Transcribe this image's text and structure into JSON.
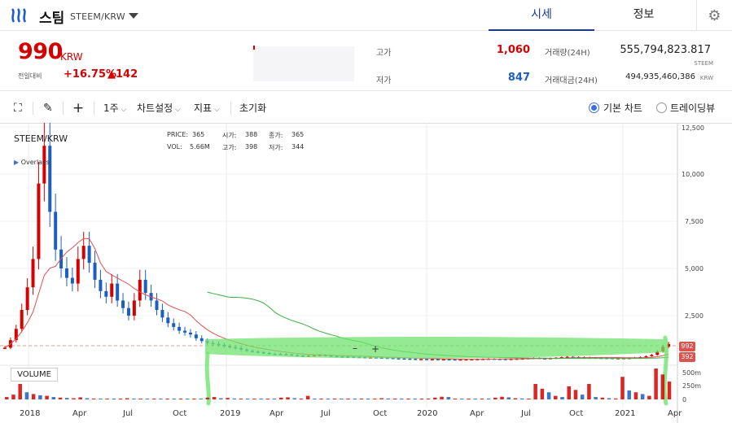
{
  "header": {
    "coin_name": "스팀",
    "pair": "STEEM/KRW",
    "tabs": [
      {
        "label": "시세",
        "active": true
      },
      {
        "label": "정보",
        "active": false
      }
    ]
  },
  "ticker": {
    "price": "990",
    "unit": "KRW",
    "change_label": "전일대비",
    "change_rate": "+16.75%",
    "change_amount": "▲142",
    "high_label": "고가",
    "high_value": "1,060",
    "low_label": "저가",
    "low_value": "847",
    "volume_label": "거래량(24H)",
    "volume_value": "555,794,823.817",
    "volume_unit": "STEEM",
    "turnover_label": "거래대금(24H)",
    "turnover_value": "494,935,460,386",
    "turnover_unit": "KRW"
  },
  "toolbar": {
    "interval": "1주",
    "chart_settings": "차트설정",
    "indicators": "지표",
    "reset": "초기화",
    "basic_chart": "기본 차트",
    "trading_view": "트레이딩뷰"
  },
  "chart_info": {
    "symbol": "STEEM/KRW",
    "overlays": "Overlays",
    "price_label": "PRICE:",
    "price": "365",
    "open_label": "시가:",
    "open": "388",
    "close_label": "종가:",
    "close": "365",
    "vol_label": "VOL:",
    "vol": "5.66M",
    "high_label": "고가:",
    "high": "398",
    "low_label": "저가:",
    "low": "344",
    "volume_panel": "VOLUME"
  },
  "colors": {
    "up": "#d60000",
    "down": "#1b5fc1",
    "accent": "#1b3a8a"
  },
  "chart_data": {
    "type": "candlestick",
    "y_ticks": [
      "12,500",
      "10,000",
      "7,500",
      "5,000",
      "2,500"
    ],
    "vol_ticks": [
      "500m",
      "250m",
      "0"
    ],
    "x_ticks": [
      "2018",
      "Apr",
      "Jul",
      "Oct",
      "2019",
      "Apr",
      "Jul",
      "Oct",
      "2020",
      "Apr",
      "Jul",
      "Oct",
      "2021",
      "Apr"
    ],
    "last_price_tags": [
      "992",
      "392"
    ],
    "price_series": [
      800,
      1200,
      1800,
      2800,
      4000,
      5500,
      9500,
      11500,
      8000,
      6000,
      5000,
      4500,
      4200,
      5500,
      6200,
      5300,
      4400,
      3800,
      3500,
      4200,
      3300,
      2900,
      2500,
      3300,
      4400,
      3700,
      3300,
      2800,
      2400,
      2100,
      1900,
      1700,
      1600,
      1500,
      1300,
      1150,
      1050,
      1000,
      950,
      880,
      830,
      780,
      700,
      640,
      600,
      560,
      520,
      480,
      470,
      460,
      440,
      410,
      380,
      365,
      380,
      400,
      420,
      380,
      360,
      340,
      330,
      320,
      310,
      300,
      290,
      290,
      280,
      270,
      260,
      240,
      230,
      220,
      210,
      200,
      200,
      195,
      195,
      190,
      190,
      185,
      180,
      180,
      185,
      190,
      200,
      210,
      220,
      210,
      205,
      200,
      210,
      220,
      230,
      250,
      260,
      240,
      230,
      250,
      270,
      300,
      320,
      310,
      300,
      290,
      280,
      270,
      265,
      260,
      250,
      250,
      255,
      260,
      280,
      300,
      350,
      420,
      600,
      850,
      990
    ],
    "volume_series": [
      40,
      80,
      260,
      120,
      90,
      70,
      60,
      40,
      30,
      25,
      20,
      35,
      20,
      15,
      10,
      8,
      6,
      10,
      20,
      8,
      6,
      5,
      4,
      6,
      8,
      5,
      4,
      3,
      5,
      7,
      30,
      40,
      20,
      25,
      15,
      10,
      12,
      8,
      6,
      5,
      4,
      30,
      35,
      20,
      15,
      60,
      12,
      6,
      4,
      3,
      3,
      4,
      5,
      4,
      8,
      12,
      20,
      15,
      10,
      4,
      3,
      5,
      6,
      15,
      30,
      45,
      40,
      12,
      8,
      5,
      6,
      4,
      3,
      30,
      45,
      35,
      20,
      15,
      10,
      260,
      180,
      120,
      60,
      40,
      220,
      160,
      80,
      260,
      40,
      30,
      20,
      15,
      380,
      150,
      120,
      90,
      60,
      520,
      420,
      300
    ],
    "volume_up": [
      true,
      true,
      true,
      false,
      true,
      false,
      true,
      false,
      true,
      false,
      true,
      true,
      false,
      true,
      false,
      true,
      false,
      true,
      true,
      false,
      true,
      false,
      true,
      false,
      true,
      false,
      true,
      false,
      true,
      false,
      true,
      true,
      false,
      true,
      false,
      true,
      false,
      true,
      false,
      true,
      false,
      true,
      true,
      false,
      true,
      true,
      false,
      true,
      false,
      true,
      false,
      true,
      false,
      true,
      false,
      true,
      true,
      false,
      true,
      false,
      true,
      false,
      true,
      true,
      true,
      true,
      false,
      true,
      false,
      true,
      false,
      true,
      false,
      true,
      true,
      false,
      true,
      false,
      true,
      true,
      true,
      false,
      true,
      false,
      true,
      true,
      false,
      true,
      false,
      true,
      false,
      true,
      true,
      false,
      true,
      false,
      true,
      true,
      true,
      true
    ]
  }
}
